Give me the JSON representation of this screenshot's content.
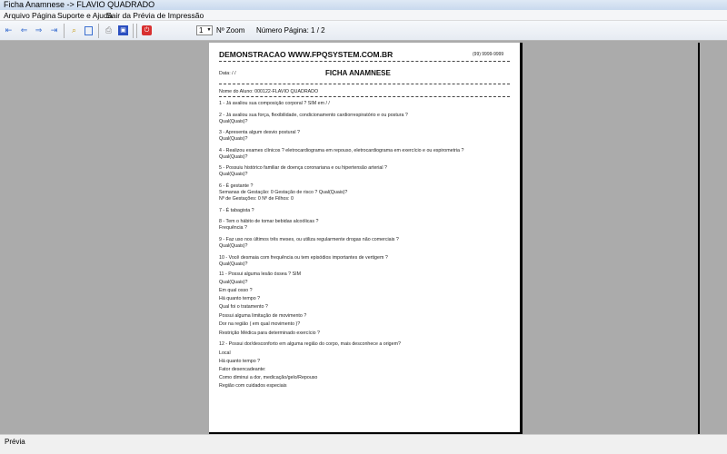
{
  "window": {
    "title": "Ficha Anamnese -> FLAVIO QUADRADO"
  },
  "menu": [
    "Arquivo",
    "Página",
    "Suporte e Ajuda",
    "Sair da Prévia de Impressão"
  ],
  "toolbar": {
    "zoom_value": "1",
    "zoom_label": "Nº Zoom",
    "page_label": "Número Página: 1 / 2",
    "icons": [
      "first-page-icon",
      "prev-page-icon",
      "next-page-icon",
      "last-page-icon",
      "search-icon",
      "page-view-icon",
      "print-icon",
      "export-icon",
      "close-icon"
    ]
  },
  "report": {
    "company": "DEMONSTRACAO WWW.FPQSYSTEM.COM.BR",
    "phone": "(99) 9999-9999",
    "date": "Data:  / /",
    "title": "FICHA ANAMNESE",
    "student": "Nome do Aluno: 000122-FLAVIO QUADRADO",
    "lines": [
      "1 - Já avaliou sua composição corporal ? SIM em   / /",
      "2 - Já avaliou sua força, flexibilidade, condicionamento cardiorrespiratório e ou postura ?",
      "Qual(Quais)?",
      "3 - Apresenta algum desvio postural ?",
      "Qual(Quais)?",
      "4 - Realizou exames clínicos ? eletrocardiograma em repouso, eletrocardiograma em exercício e ou espirometria ?",
      "Qual(Quais)?",
      "5 - Possuiu histórico familiar de doença coronariana e ou hipertensão arterial ?",
      "Qual(Quais)?",
      "6 - É gestante ?",
      "Semanas de Gestação:  0    Gestação de risco ?              Qual(Quais)?",
      "Nº de Gestações:  0            Nº de Filhos:  0",
      "7 - É tabagista ?",
      "8 - Tem o hábito de tomar bebidas alcoólicas ?",
      "Frequência ?",
      "9 - Faz uso nos últimos três meses, ou utiliza regularmente drogas não comerciais ?",
      "Qual(Quais)?",
      "10 - Você desmaia com frequência ou tem episódios importantes de vertigem ?",
      "Qual(Quais)?",
      "11 - Possui alguma lesão óssea ? SIM",
      "Qual(Quais)?",
      "Em qual osso ?",
      "Há quanto tempo ?",
      "Qual foi o tratamento ?",
      "Possui alguma limitação de movimento ?",
      "Dor na região ( em qual movimento )?",
      "Restrição Médica para determinado exercício ?",
      "12 - Possui dor/desconforto em alguma região do corpo, mais desconhece a origem?",
      "Local",
      "Há quanto tempo ?",
      "Fator desencadeante:",
      "Como diminui a dor, medicação/gelo/Repouso",
      "Região com cuidados especiais"
    ]
  },
  "status": {
    "text": "Prévia"
  }
}
